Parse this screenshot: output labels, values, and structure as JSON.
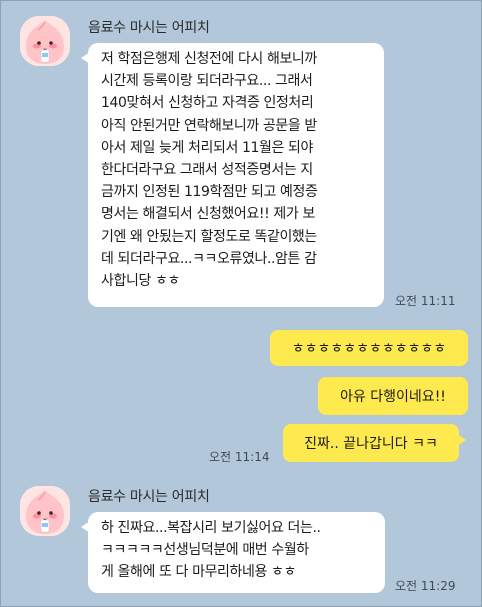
{
  "messages": [
    {
      "sender": "음료수 마시는 어피치",
      "lines": [
        "저 학점은행제 신청전에 다시 해보니까",
        " 시간제 등록이랑 되더라구요... 그래서",
        "140맞혀서 신청하고 자격증 인정처리",
        "아직 안된거만 연락해보니까 공문을 받",
        "아서 제일 늦게 처리되서 11월은 되야",
        "한다더라구요 그래서 성적증명서는 지",
        "금까지 인정된 119학점만 되고 예정증",
        "명서는 해결되서 신청했어요!! 제가 보",
        "기엔 왜 안됬는지 할정도로 똑같이했는",
        "데 되더라구요...ㅋㅋ오류였나..암튼 감",
        "사합니당 ㅎㅎ"
      ],
      "time": "오전 11:11"
    },
    {
      "mine": [
        "ㅎㅎㅎㅎㅎㅎㅎㅎㅎㅎㅎㅎ",
        "아유 다행이네요!!",
        "진짜.. 끝나갑니다 ㅋㅋ"
      ],
      "time": "오전 11:14"
    },
    {
      "sender": "음료수 마시는 어피치",
      "lines": [
        "하 진짜요...복잡시리 보기싫어요 더는..",
        "ㅋㅋㅋㅋㅋ선생님덕분에 매번 수월하",
        "게 올해에 또 다 마무리하네용 ㅎㅎ"
      ],
      "time": "오전 11:29"
    }
  ]
}
